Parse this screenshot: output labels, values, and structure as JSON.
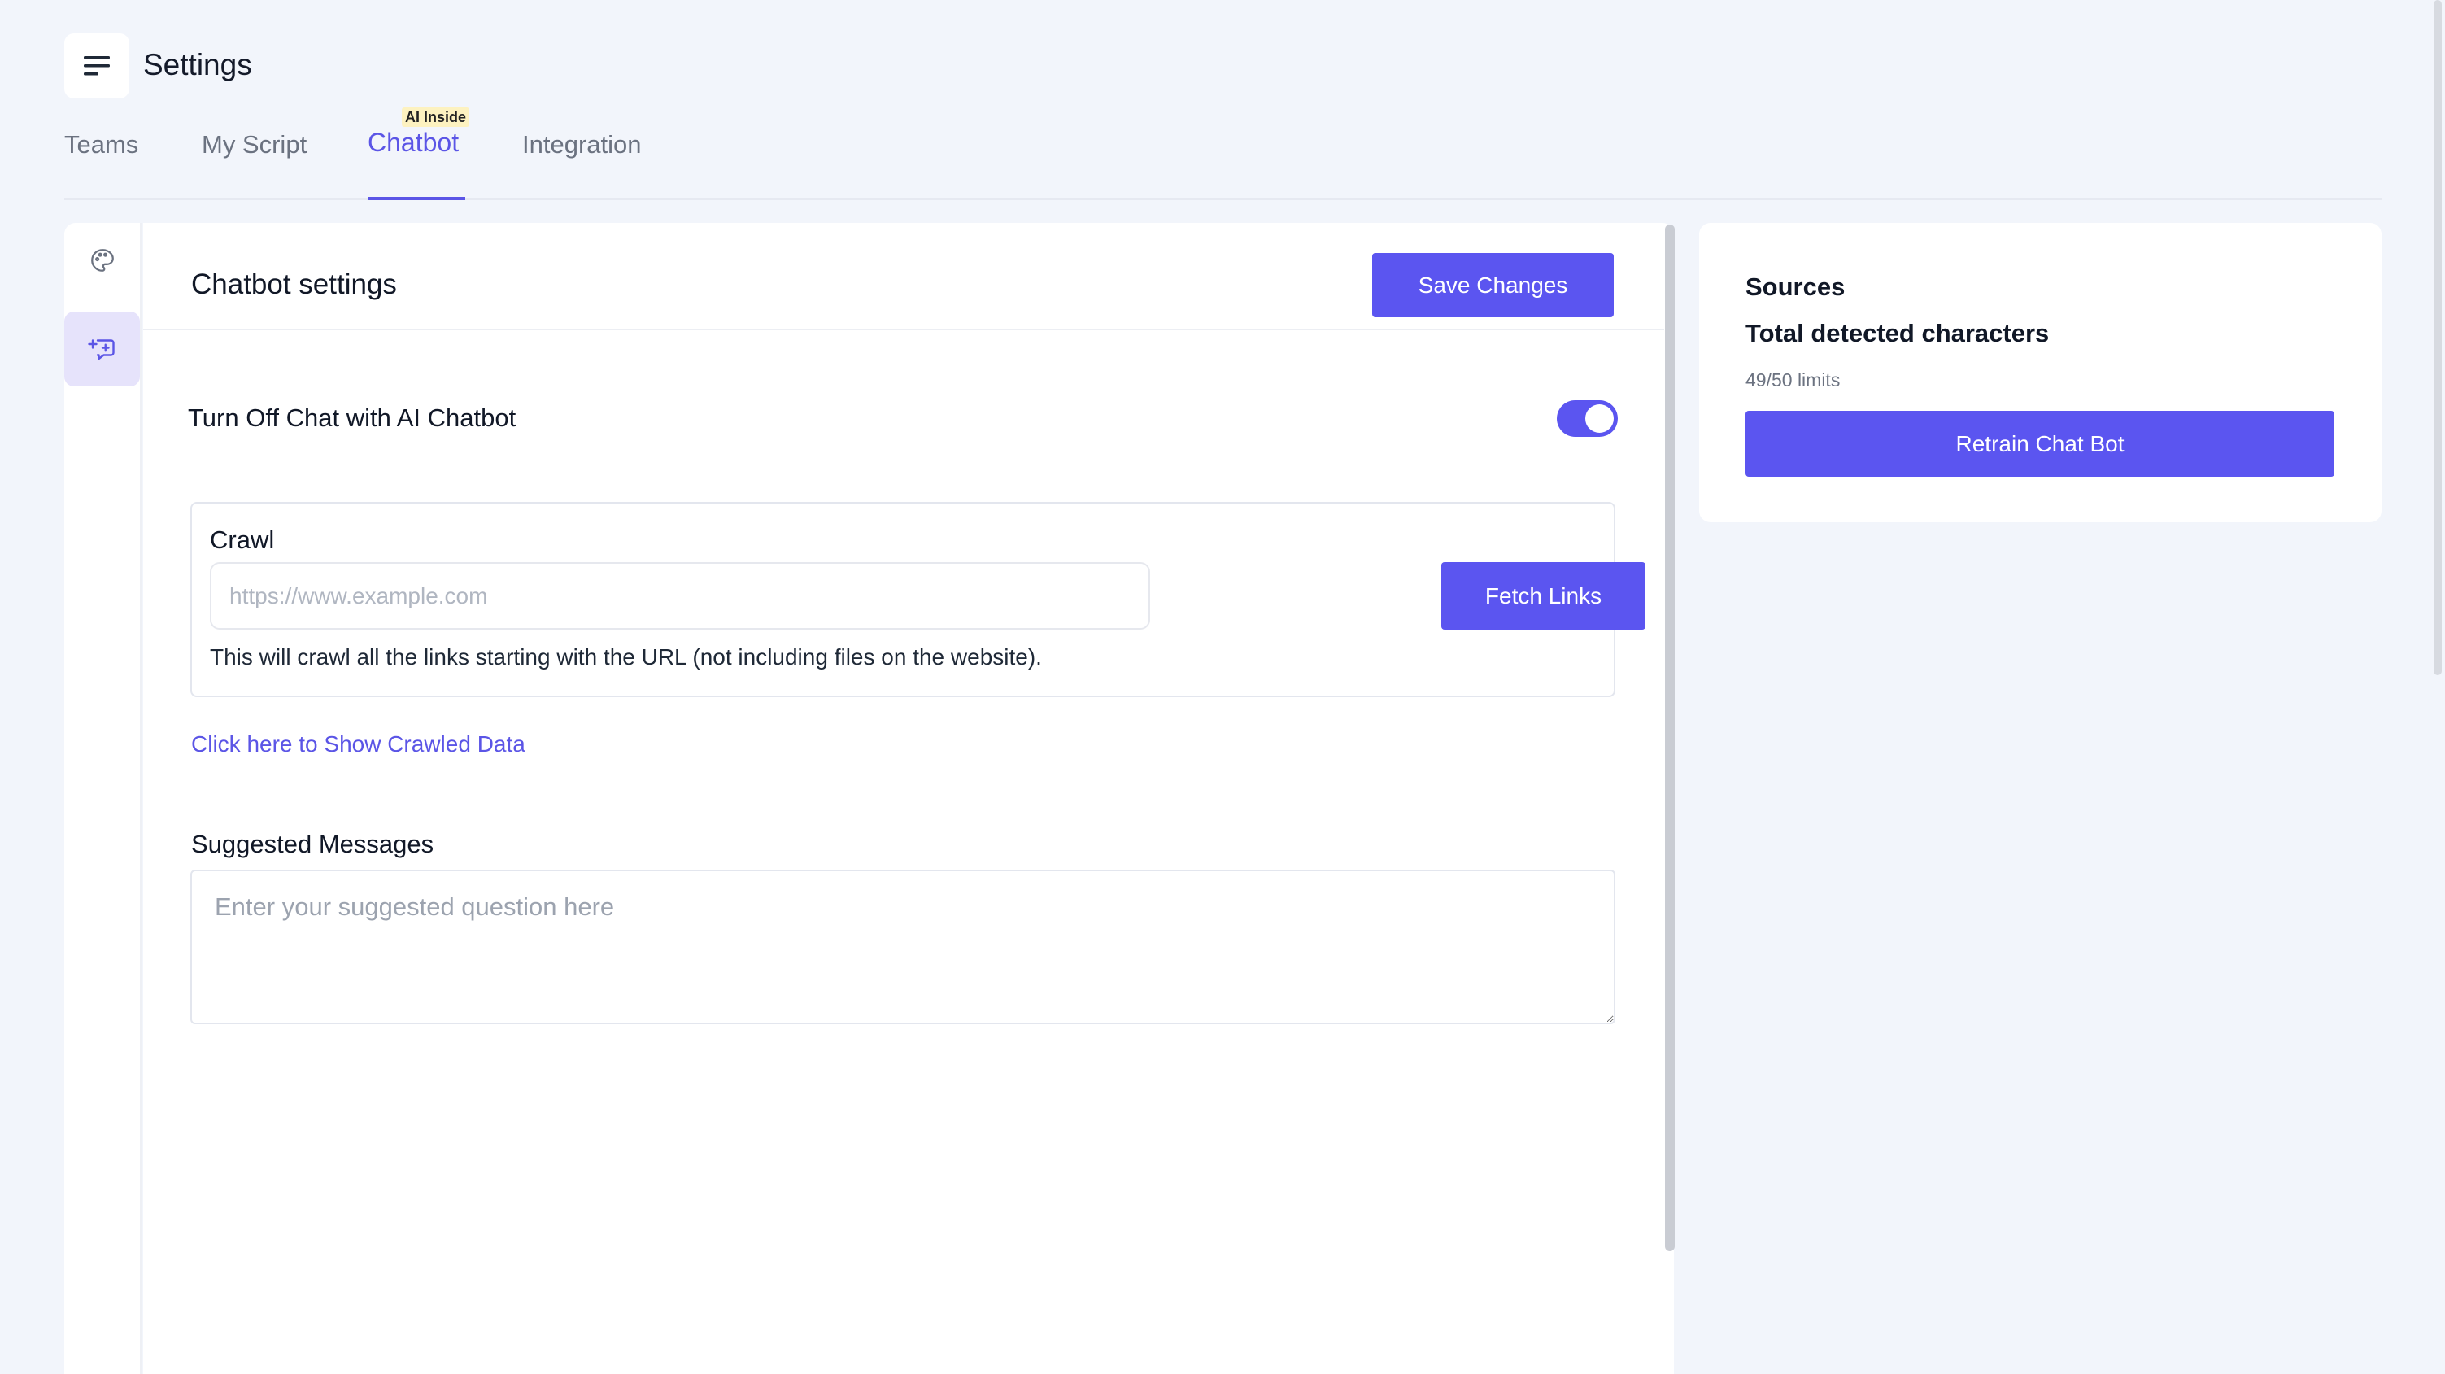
{
  "header": {
    "menu_icon": "hamburger-menu-icon",
    "title": "Settings"
  },
  "tabs": [
    {
      "label": "Teams",
      "active": false
    },
    {
      "label": "My Script",
      "active": false
    },
    {
      "label": "Chatbot",
      "active": true,
      "badge": "AI Inside"
    },
    {
      "label": "Integration",
      "active": false
    }
  ],
  "rail": {
    "items": [
      {
        "icon": "palette-icon",
        "active": false
      },
      {
        "icon": "chat-add-icon",
        "active": true
      }
    ]
  },
  "main": {
    "title": "Chatbot settings",
    "save_label": "Save Changes",
    "toggle_label": "Turn Off Chat with AI Chatbot",
    "toggle_on": true,
    "crawl": {
      "title": "Crawl",
      "placeholder": "https://www.example.com",
      "fetch_label": "Fetch Links",
      "hint": "This will crawl all the links starting with the URL (not including files on the website)."
    },
    "show_crawled_label": "Click here to Show Crawled Data",
    "suggested": {
      "label": "Suggested Messages",
      "placeholder": "Enter your suggested question here"
    }
  },
  "sources": {
    "title": "Sources",
    "subtitle": "Total detected characters",
    "limit": "49/50 limits",
    "retrain_label": "Retrain Chat Bot"
  },
  "colors": {
    "accent": "#5b55f0",
    "background": "#f2f5fb",
    "badge_bg": "#fdf2c0"
  }
}
